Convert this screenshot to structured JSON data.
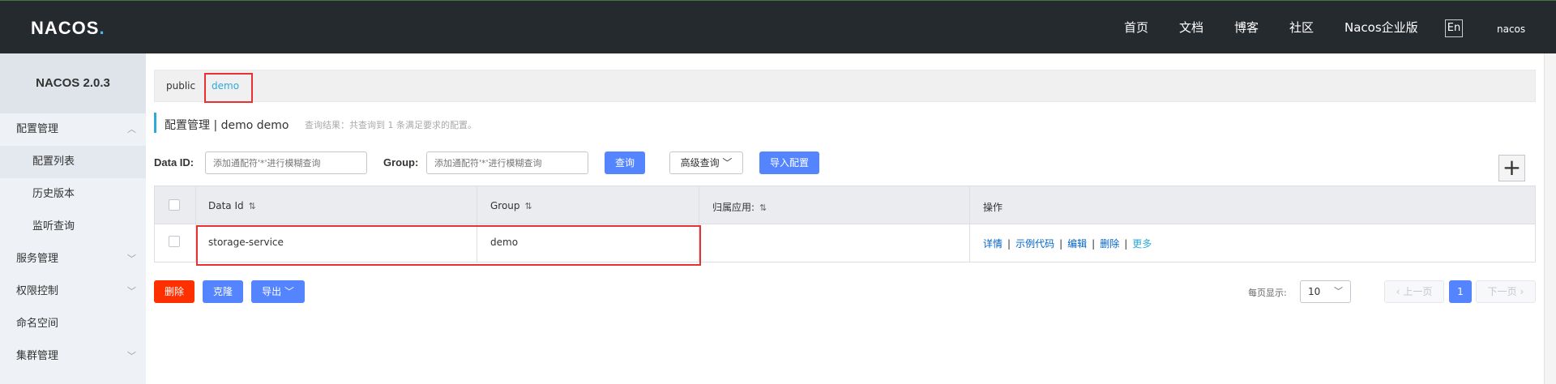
{
  "app": {
    "logo": "NACOS",
    "logo_dot": ".",
    "nav": [
      "首页",
      "文档",
      "博客",
      "社区",
      "Nacos企业版"
    ],
    "lang": "En",
    "user": "nacos"
  },
  "sidebar": {
    "version": "NACOS 2.0.3",
    "items": [
      {
        "label": "配置管理",
        "expanded": true
      },
      {
        "label": "配置列表"
      },
      {
        "label": "历史版本"
      },
      {
        "label": "监听查询"
      },
      {
        "label": "服务管理"
      },
      {
        "label": "权限控制"
      },
      {
        "label": "命名空间"
      },
      {
        "label": "集群管理"
      }
    ]
  },
  "namespaces": {
    "tabs": [
      "public",
      "demo"
    ],
    "active": "demo"
  },
  "page": {
    "title": "配置管理 | demo  demo",
    "hint": "查询结果：共查询到 1 条满足要求的配置。"
  },
  "filters": {
    "data_id_label": "Data ID:",
    "data_id_placeholder": "添加通配符'*'进行模糊查询",
    "group_label": "Group:",
    "group_placeholder": "添加通配符'*'进行模糊查询",
    "search_button": "查询",
    "advanced_button": "高级查询",
    "import_button": "导入配置",
    "add_button": "+"
  },
  "table": {
    "columns": [
      "Data Id",
      "Group",
      "归属应用:",
      "操作"
    ],
    "sort_icon": "⇅",
    "rows": [
      {
        "data_id": "storage-service",
        "group": "demo",
        "app": "",
        "ops": [
          "详情",
          "示例代码",
          "编辑",
          "删除"
        ],
        "more": "更多"
      }
    ]
  },
  "bulk": {
    "delete": "删除",
    "clone": "克隆",
    "export": "导出"
  },
  "pagination": {
    "page_size_label": "每页显示:",
    "page_size": "10",
    "prev": "上一页",
    "current": "1",
    "next": "下一页"
  },
  "colors": {
    "header_bg": "#252a2f",
    "primary": "#5584ff",
    "danger": "#ff3000",
    "accent": "#2fa9d8",
    "highlight_box": "#e83232"
  }
}
